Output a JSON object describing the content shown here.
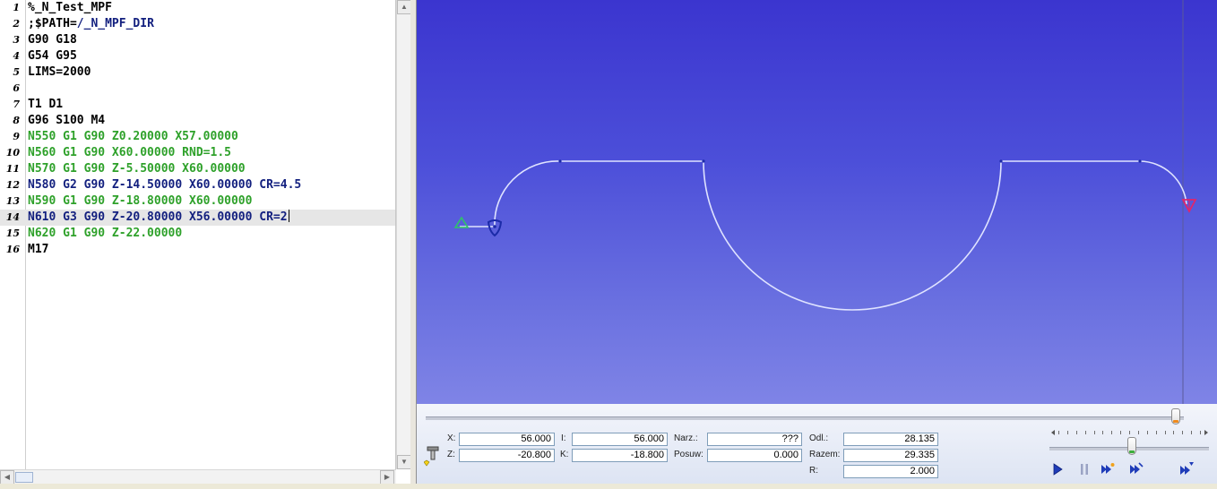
{
  "editor": {
    "lines": [
      {
        "num": "1",
        "segments": [
          {
            "text": "%_N_Test_MPF",
            "color": "black"
          }
        ]
      },
      {
        "num": "2",
        "segments": [
          {
            "text": ";$PATH=",
            "color": "black"
          },
          {
            "text": "/_N_MPF_DIR",
            "color": "navy"
          }
        ]
      },
      {
        "num": "3",
        "segments": [
          {
            "text": "G90 G18",
            "color": "black"
          }
        ]
      },
      {
        "num": "4",
        "segments": [
          {
            "text": "G54 G95",
            "color": "black"
          }
        ]
      },
      {
        "num": "5",
        "segments": [
          {
            "text": "LIMS=2000",
            "color": "black"
          }
        ]
      },
      {
        "num": "6",
        "segments": [
          {
            "text": "",
            "color": "black"
          }
        ]
      },
      {
        "num": "7",
        "segments": [
          {
            "text": "T1 D1",
            "color": "black"
          }
        ]
      },
      {
        "num": "8",
        "segments": [
          {
            "text": "G96 S100 M4",
            "color": "black"
          }
        ]
      },
      {
        "num": "9",
        "segments": [
          {
            "text": "N550 G1 G90 Z0.20000 X57.00000",
            "color": "green"
          }
        ]
      },
      {
        "num": "10",
        "segments": [
          {
            "text": "N560 G1 G90 X60.00000 RND=1.5",
            "color": "green"
          }
        ]
      },
      {
        "num": "11",
        "segments": [
          {
            "text": "N570 G1 G90 Z-5.50000 X60.00000",
            "color": "green"
          }
        ]
      },
      {
        "num": "12",
        "segments": [
          {
            "text": "N580 G2 G90 Z-14.50000 X60.00000 CR=4.5",
            "color": "navy"
          }
        ]
      },
      {
        "num": "13",
        "segments": [
          {
            "text": "N590 G1 G90 Z-18.80000 X60.00000",
            "color": "green"
          }
        ]
      },
      {
        "num": "14",
        "segments": [
          {
            "text": "N610 G3 G90 Z-20.80000 X56.00000 CR=2",
            "color": "navy"
          }
        ],
        "current": true
      },
      {
        "num": "15",
        "segments": [
          {
            "text": "N620 G1 G90 Z-22.00000",
            "color": "green"
          }
        ]
      },
      {
        "num": "16",
        "segments": [
          {
            "text": "M17",
            "color": "black"
          }
        ]
      }
    ]
  },
  "readout": {
    "x_label": "X:",
    "x_value": "56.000",
    "z_label": "Z:",
    "z_value": "-20.800",
    "i_label": "I:",
    "i_value": "56.000",
    "k_label": "K:",
    "k_value": "-18.800",
    "narz_label": "Narz.:",
    "narz_value": "???",
    "posuw_label": "Posuw:",
    "posuw_value": "0.000",
    "odl_label": "Odl.:",
    "odl_value": "28.135",
    "razem_label": "Razem:",
    "razem_value": "29.335",
    "r_label": "R:",
    "r_value": "2.000"
  },
  "playback": {
    "timeline_progress": 0.995,
    "speed_level": 0.5
  },
  "colors": {
    "code_green": "#2ea12a",
    "code_navy": "#13207f",
    "toolpath": "#dfe3ff",
    "start_marker": "#2fc468",
    "end_marker": "#e0266b",
    "tool_marker": "#1b2aa8"
  },
  "icons": {
    "tool": "tool-icon",
    "play": "play-icon",
    "pause": "pause-icon",
    "step_forward": "step-forward-icon",
    "step_tool": "step-tool-icon",
    "fast_forward": "fast-forward-icon"
  }
}
